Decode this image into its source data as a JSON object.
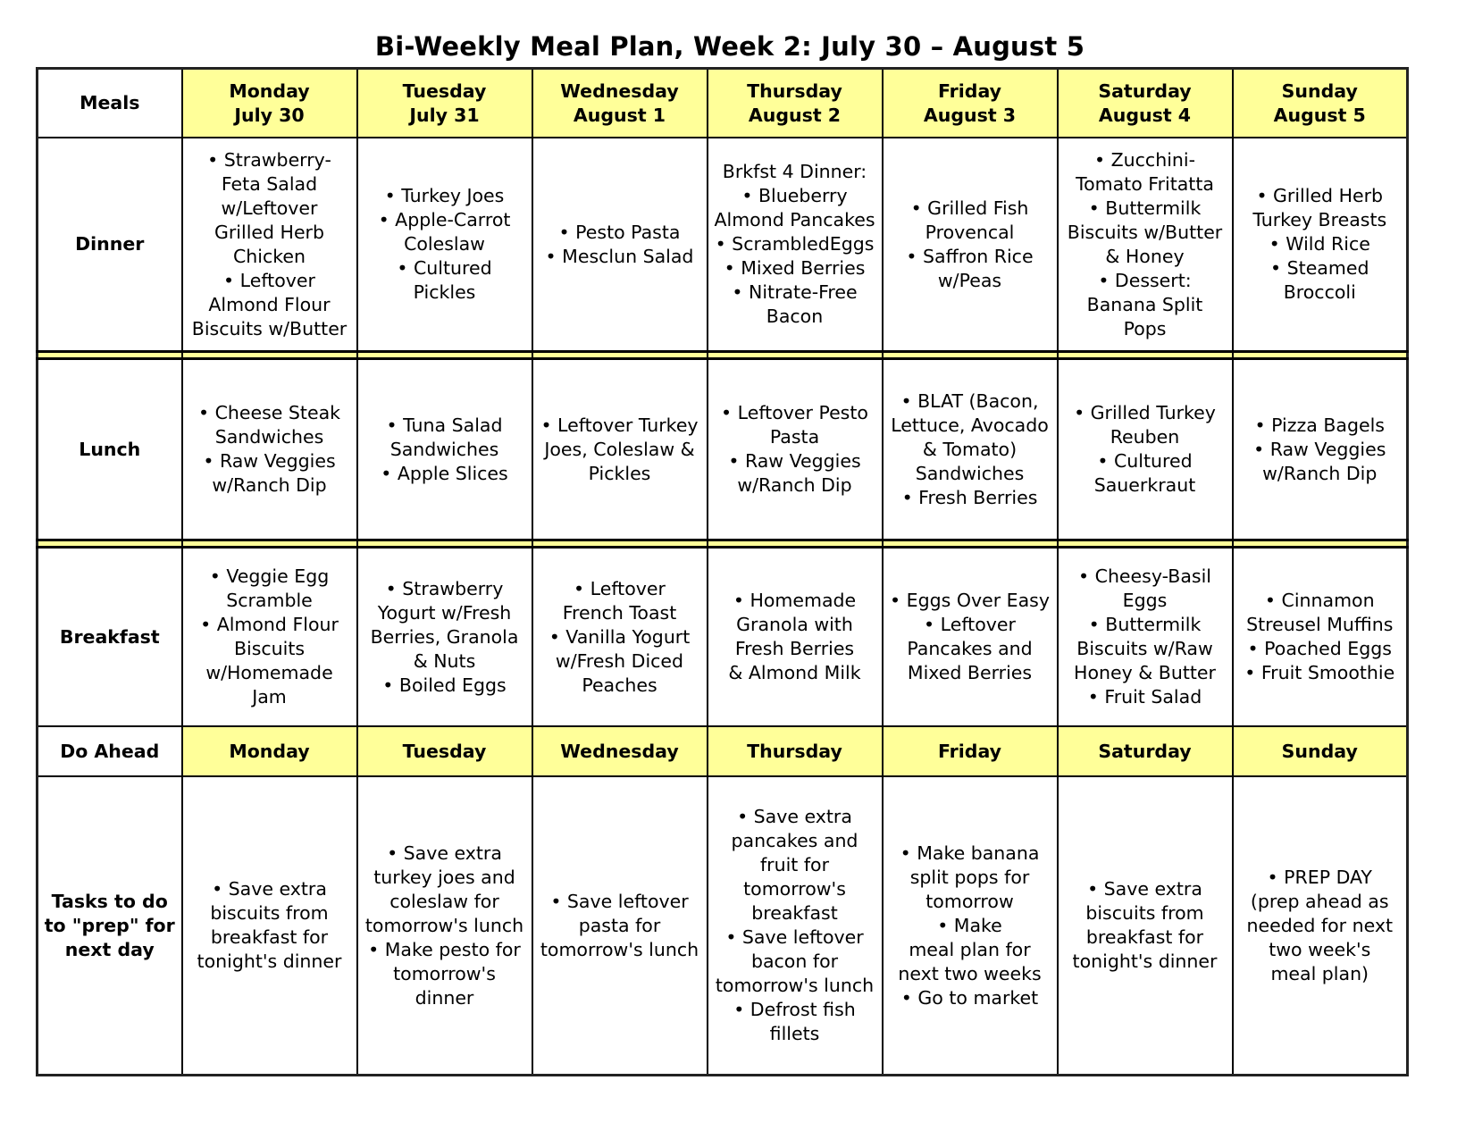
{
  "title": "Bi-Weekly Meal Plan, Week 2: July 30 – August 5",
  "colors": {
    "header_fill": "#ffff99",
    "border": "#000000"
  },
  "header": {
    "meals_label": "Meals",
    "days": [
      {
        "day": "Monday",
        "date": "July 30"
      },
      {
        "day": "Tuesday",
        "date": "July 31"
      },
      {
        "day": "Wednesday",
        "date": "August 1"
      },
      {
        "day": "Thursday",
        "date": "August 2"
      },
      {
        "day": "Friday",
        "date": "August 3"
      },
      {
        "day": "Saturday",
        "date": "August 4"
      },
      {
        "day": "Sunday",
        "date": "August 5"
      }
    ]
  },
  "rows": {
    "dinner": {
      "label": "Dinner",
      "cells": [
        [
          "• Strawberry-",
          "Feta Salad",
          "w/Leftover",
          "Grilled Herb",
          "Chicken",
          "• Leftover",
          "Almond Flour",
          "Biscuits w/Butter"
        ],
        [
          "• Turkey Joes",
          "• Apple-Carrot",
          "Coleslaw",
          "• Cultured",
          "Pickles"
        ],
        [
          "• Pesto Pasta",
          "• Mesclun Salad"
        ],
        [
          "Brkfst 4 Dinner:",
          "• Blueberry",
          "Almond Pancakes",
          "• ScrambledEggs",
          "• Mixed Berries",
          "• Nitrate-Free",
          "Bacon"
        ],
        [
          "• Grilled Fish",
          "Provencal",
          "• Saffron Rice",
          "w/Peas"
        ],
        [
          "• Zucchini-",
          "Tomato Fritatta",
          "• Buttermilk",
          "Biscuits w/Butter",
          "& Honey",
          "• Dessert:",
          "Banana Split",
          "Pops"
        ],
        [
          "• Grilled Herb",
          "Turkey Breasts",
          "• Wild Rice",
          "• Steamed",
          "Broccoli"
        ]
      ]
    },
    "lunch": {
      "label": "Lunch",
      "cells": [
        [
          "• Cheese Steak",
          "Sandwiches",
          "• Raw Veggies",
          "w/Ranch Dip"
        ],
        [
          "• Tuna Salad",
          "Sandwiches",
          "• Apple Slices"
        ],
        [
          "• Leftover Turkey",
          "Joes, Coleslaw &",
          "Pickles"
        ],
        [
          "• Leftover Pesto",
          "Pasta",
          "• Raw Veggies",
          "w/Ranch Dip"
        ],
        [
          "• BLAT (Bacon,",
          "Lettuce, Avocado",
          "& Tomato)",
          "Sandwiches",
          "• Fresh Berries"
        ],
        [
          "• Grilled Turkey",
          "Reuben",
          "• Cultured",
          "Sauerkraut"
        ],
        [
          "• Pizza Bagels",
          "• Raw Veggies",
          "w/Ranch Dip"
        ]
      ]
    },
    "breakfast": {
      "label": "Breakfast",
      "cells": [
        [
          "• Veggie Egg",
          "Scramble",
          "• Almond Flour",
          "Biscuits",
          "w/Homemade",
          "Jam"
        ],
        [
          "• Strawberry",
          "Yogurt w/Fresh",
          "Berries, Granola",
          "& Nuts",
          "• Boiled Eggs"
        ],
        [
          "• Leftover",
          "French Toast",
          "• Vanilla Yogurt",
          "w/Fresh Diced",
          "Peaches"
        ],
        [
          "• Homemade",
          "Granola with",
          "Fresh Berries",
          "& Almond Milk"
        ],
        [
          "• Eggs Over Easy",
          "• Leftover",
          "Pancakes and",
          "Mixed Berries"
        ],
        [
          "• Cheesy-Basil",
          "Eggs",
          "• Buttermilk",
          "Biscuits w/Raw",
          "Honey & Butter",
          "• Fruit Salad"
        ],
        [
          "• Cinnamon",
          "Streusel Muffins",
          "• Poached Eggs",
          "• Fruit Smoothie"
        ]
      ]
    },
    "do_ahead": {
      "label": "Do Ahead",
      "days": [
        "Monday",
        "Tuesday",
        "Wednesday",
        "Thursday",
        "Friday",
        "Saturday",
        "Sunday"
      ]
    },
    "tasks": {
      "label_lines": [
        "Tasks to do",
        "to \"prep\" for",
        "next day"
      ],
      "cells": [
        [
          "• Save extra",
          "biscuits from",
          "breakfast for",
          "tonight's dinner"
        ],
        [
          "• Save extra",
          "turkey joes and",
          "coleslaw for",
          "tomorrow's lunch",
          "• Make pesto for",
          "tomorrow's",
          "dinner"
        ],
        [
          "• Save leftover",
          "pasta for",
          "tomorrow's lunch"
        ],
        [
          "• Save extra",
          "pancakes and",
          "fruit for",
          "tomorrow's",
          "breakfast",
          "• Save leftover",
          "bacon for",
          "tomorrow's lunch",
          "• Defrost fish",
          "fillets"
        ],
        [
          "• Make banana",
          "split pops for",
          "tomorrow",
          "• Make",
          "meal plan for",
          "next two weeks",
          "• Go to market"
        ],
        [
          "• Save extra",
          "biscuits from",
          "breakfast for",
          "tonight's dinner"
        ],
        [
          "• PREP DAY",
          "(prep ahead as",
          "needed for next",
          "two week's",
          "meal plan)"
        ]
      ]
    }
  }
}
